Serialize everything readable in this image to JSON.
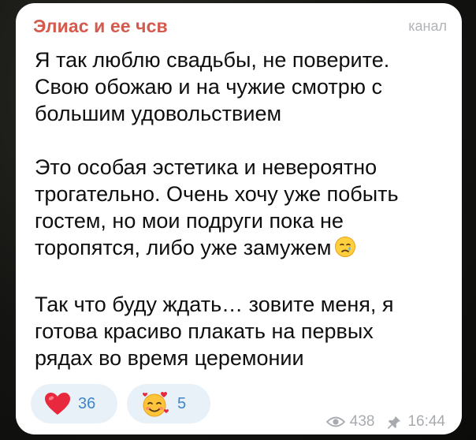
{
  "post": {
    "channel_name": "Элиас и ее чсв",
    "channel_tag": "канал",
    "paragraphs": [
      [
        "Я так люблю свадьбы, не поверите.",
        "Свою обожаю и на чужие смотрю с",
        "большим удовольствием"
      ],
      [
        "Это особая эстетика и невероятно",
        "трогательно. Очень хочу уже побыть",
        "гостем, но мои подруги пока не",
        "торопятся, либо уже замужем"
      ],
      [
        "Так что буду ждать… зовите меня, я",
        "готова красиво плакать на первых",
        "рядах во время церемонии"
      ]
    ],
    "inline_emoji": "crying-face-emoji"
  },
  "reactions": [
    {
      "icon": "red-heart-icon",
      "count": "36"
    },
    {
      "icon": "smiling-face-with-hearts-icon",
      "count": "5"
    }
  ],
  "meta": {
    "views_icon": "eye-icon",
    "views": "438",
    "pin_icon": "pin-icon",
    "time": "16:44"
  },
  "colors": {
    "channel_name": "#d35a4c",
    "reaction_bg": "#e9f1f8",
    "reaction_count": "#3d86c8",
    "meta_text": "#a7abb0"
  }
}
